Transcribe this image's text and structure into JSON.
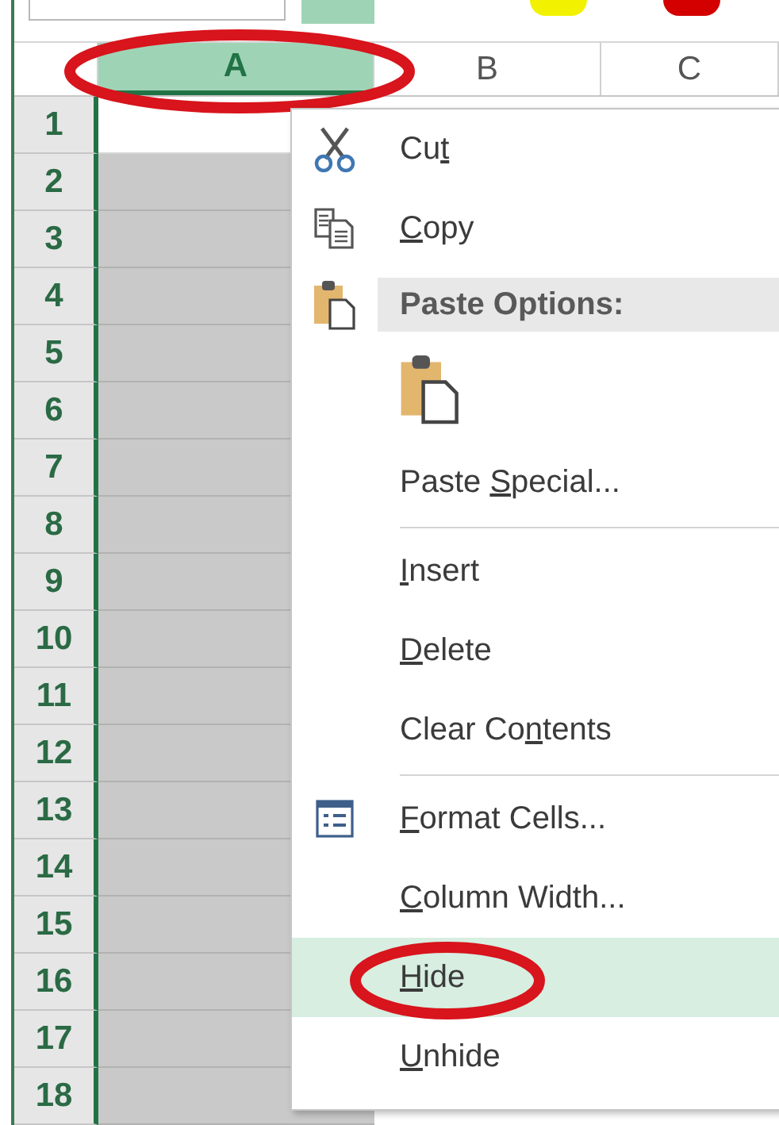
{
  "ribbon_swatches": [
    {
      "color": "#9fd3b6"
    },
    {
      "color": "#f2f200"
    },
    {
      "color": "#d40000"
    }
  ],
  "columns": [
    {
      "label": "A",
      "selected": true,
      "circled": true
    },
    {
      "label": "B",
      "selected": false,
      "circled": false
    },
    {
      "label": "C",
      "selected": false,
      "circled": false
    }
  ],
  "rows": [
    {
      "label": "1",
      "active": true
    },
    {
      "label": "2",
      "active": false
    },
    {
      "label": "3",
      "active": false
    },
    {
      "label": "4",
      "active": false
    },
    {
      "label": "5",
      "active": false
    },
    {
      "label": "6",
      "active": false
    },
    {
      "label": "7",
      "active": false
    },
    {
      "label": "8",
      "active": false
    },
    {
      "label": "9",
      "active": false
    },
    {
      "label": "10",
      "active": false
    },
    {
      "label": "11",
      "active": false
    },
    {
      "label": "12",
      "active": false
    },
    {
      "label": "13",
      "active": false
    },
    {
      "label": "14",
      "active": false
    },
    {
      "label": "15",
      "active": false
    },
    {
      "label": "16",
      "active": false
    },
    {
      "label": "17",
      "active": false
    },
    {
      "label": "18",
      "active": false
    }
  ],
  "context_menu": {
    "items": [
      {
        "kind": "cut",
        "pre": "Cu",
        "key": "t",
        "selected": false,
        "circled": false,
        "divider_before": false
      },
      {
        "kind": "copy",
        "key": "C",
        "post": "opy",
        "selected": false,
        "circled": false,
        "divider_before": false
      },
      {
        "kind": "pasteheader",
        "pre": "Paste Options:",
        "selected": false,
        "circled": false,
        "divider_before": false
      },
      {
        "kind": "pasteoption",
        "selected": false
      },
      {
        "kind": "plain",
        "pre": "Paste ",
        "key": "S",
        "post": "pecial...",
        "selected": false,
        "circled": false,
        "divider_before": false
      },
      {
        "kind": "plain",
        "key": "I",
        "post": "nsert",
        "selected": false,
        "circled": false,
        "divider_before": true
      },
      {
        "kind": "plain",
        "key": "D",
        "post": "elete",
        "selected": false,
        "circled": false,
        "divider_before": false
      },
      {
        "kind": "plain",
        "pre": "Clear Co",
        "key": "n",
        "post": "tents",
        "selected": false,
        "circled": false,
        "divider_before": false
      },
      {
        "kind": "format",
        "key": "F",
        "post": "ormat Cells...",
        "selected": false,
        "circled": false,
        "divider_before": true
      },
      {
        "kind": "plain",
        "key": "C",
        "post": "olumn Width...",
        "selected": false,
        "circled": false,
        "divider_before": false
      },
      {
        "kind": "plain",
        "key": "H",
        "post": "ide",
        "selected": true,
        "circled": true,
        "divider_before": false
      },
      {
        "kind": "plain",
        "key": "U",
        "post": "nhide",
        "selected": false,
        "circled": false,
        "divider_before": false
      }
    ]
  }
}
